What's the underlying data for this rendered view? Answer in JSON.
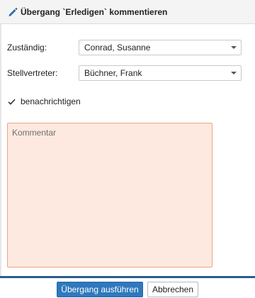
{
  "dialog": {
    "title": "Übergang `Erledigen` kommentieren",
    "title_icon": "pencil-icon"
  },
  "form": {
    "assignee_label": "Zuständig:",
    "assignee_value": "Conrad, Susanne",
    "deputy_label": "Stellvertreter:",
    "deputy_value": "Büchner, Frank",
    "notify_label": "benachrichtigen",
    "notify_checked": true,
    "comment_placeholder": "Kommentar"
  },
  "footer": {
    "execute_label": "Übergang ausführen",
    "cancel_label": "Abbrechen"
  },
  "colors": {
    "primary": "#2f78bd",
    "comment_bg": "#fde9df",
    "comment_border": "#f0a286",
    "footer_line": "#2a5d8f"
  }
}
